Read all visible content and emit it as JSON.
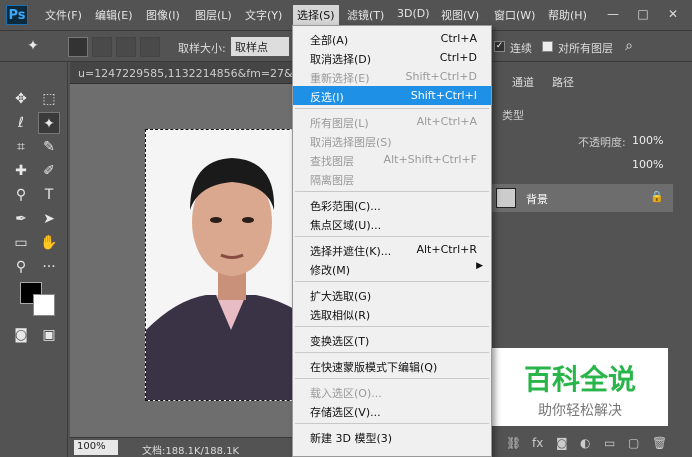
{
  "app": {
    "logo": "Ps"
  },
  "menubar": {
    "items": [
      "文件(F)",
      "编辑(E)",
      "图像(I)",
      "图层(L)",
      "文字(Y)",
      "选择(S)",
      "滤镜(T)",
      "3D(D)",
      "视图(V)",
      "窗口(W)",
      "帮助(H)"
    ],
    "active_index": 5,
    "window_controls": [
      "—",
      "□",
      "✕"
    ]
  },
  "options_bar": {
    "sample_size_label": "取样大小:",
    "sample_size_value": "取样点",
    "contiguous_label": "连续",
    "contiguous_checked": true,
    "all_layers_label": "对所有图层",
    "all_layers_checked": false
  },
  "document": {
    "tab_title": "u=1247229585,1132214856&fm=27&gp=",
    "zoom": "100%",
    "doc_info": "文档:188.1K/188.1K"
  },
  "right_panel": {
    "tabs": [
      "通道",
      "路径"
    ],
    "kind_label": "类型",
    "opacity_label": "不透明度:",
    "opacity_value": "100%",
    "fill_value": "100%",
    "layer_name": "背景"
  },
  "select_menu": {
    "groups": [
      [
        {
          "label": "全部(A)",
          "shortcut": "Ctrl+A",
          "disabled": false
        },
        {
          "label": "取消选择(D)",
          "shortcut": "Ctrl+D",
          "disabled": false
        },
        {
          "label": "重新选择(E)",
          "shortcut": "Shift+Ctrl+D",
          "disabled": true
        },
        {
          "label": "反选(I)",
          "shortcut": "Shift+Ctrl+I",
          "disabled": false,
          "highlighted": true
        }
      ],
      [
        {
          "label": "所有图层(L)",
          "shortcut": "Alt+Ctrl+A",
          "disabled": true
        },
        {
          "label": "取消选择图层(S)",
          "shortcut": "",
          "disabled": true
        },
        {
          "label": "查找图层",
          "shortcut": "Alt+Shift+Ctrl+F",
          "disabled": true
        },
        {
          "label": "隔离图层",
          "shortcut": "",
          "disabled": true
        }
      ],
      [
        {
          "label": "色彩范围(C)...",
          "shortcut": "",
          "disabled": false
        },
        {
          "label": "焦点区域(U)...",
          "shortcut": "",
          "disabled": false
        }
      ],
      [
        {
          "label": "选择并遮住(K)...",
          "shortcut": "Alt+Ctrl+R",
          "disabled": false
        },
        {
          "label": "修改(M)",
          "shortcut": "",
          "disabled": false,
          "submenu": true
        }
      ],
      [
        {
          "label": "扩大选取(G)",
          "shortcut": "",
          "disabled": false
        },
        {
          "label": "选取相似(R)",
          "shortcut": "",
          "disabled": false
        }
      ],
      [
        {
          "label": "变换选区(T)",
          "shortcut": "",
          "disabled": false
        }
      ],
      [
        {
          "label": "在快速蒙版模式下编辑(Q)",
          "shortcut": "",
          "disabled": false
        }
      ],
      [
        {
          "label": "载入选区(O)...",
          "shortcut": "",
          "disabled": true
        },
        {
          "label": "存储选区(V)...",
          "shortcut": "",
          "disabled": false
        }
      ],
      [
        {
          "label": "新建 3D 模型(3)",
          "shortcut": "",
          "disabled": false
        }
      ]
    ]
  },
  "watermark": {
    "title": "百科全说",
    "subtitle": "助你轻松解决"
  },
  "colors": {
    "highlight": "#1e90e6",
    "brand_green": "#2ab54a"
  },
  "icons": [
    "move-icon",
    "marquee-icon",
    "lasso-icon",
    "magic-wand-icon",
    "crop-icon",
    "eyedropper-icon",
    "healing-icon",
    "brush-icon",
    "stamp-icon",
    "eraser-icon",
    "gradient-icon",
    "text-icon",
    "pen-icon",
    "path-select-icon",
    "shape-icon",
    "hand-icon",
    "zoom-icon",
    "more-icon"
  ]
}
